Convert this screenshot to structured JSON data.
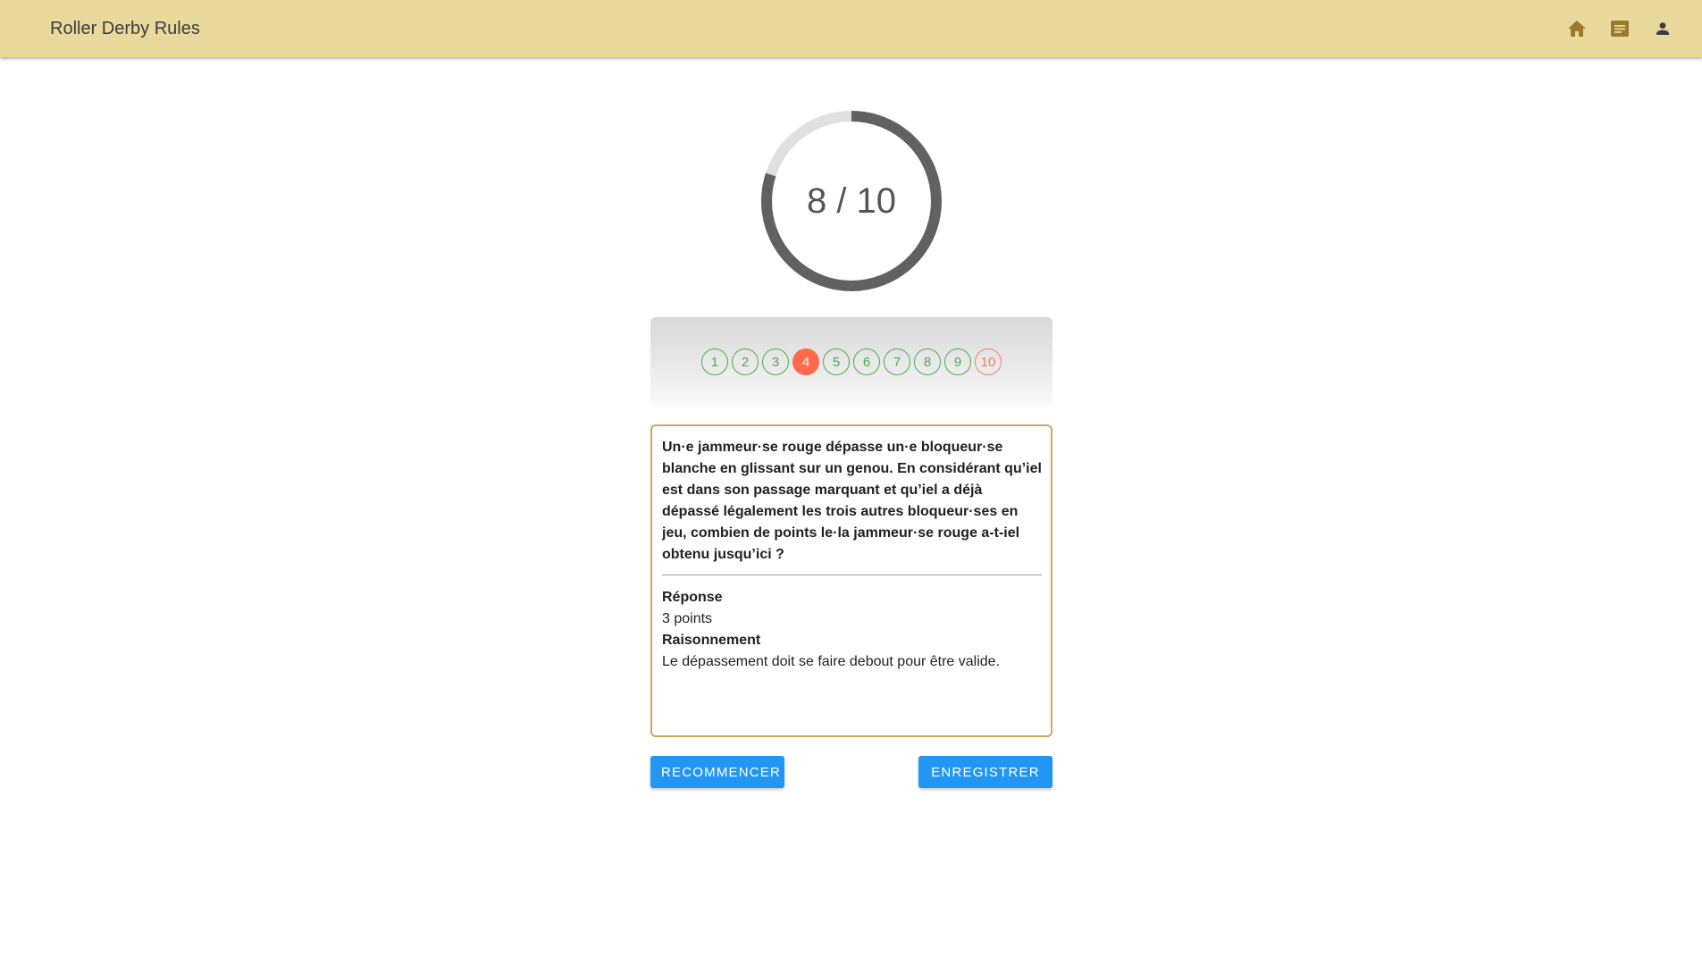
{
  "header": {
    "title": "Roller Derby Rules",
    "icons": [
      "home-icon",
      "quiz-icon",
      "account-icon"
    ]
  },
  "score": {
    "text": "8 / 10",
    "correct": 8,
    "total": 10
  },
  "steps": [
    {
      "label": "1",
      "state": "correct"
    },
    {
      "label": "2",
      "state": "correct"
    },
    {
      "label": "3",
      "state": "correct"
    },
    {
      "label": "4",
      "state": "current"
    },
    {
      "label": "5",
      "state": "correct"
    },
    {
      "label": "6",
      "state": "correct"
    },
    {
      "label": "7",
      "state": "correct"
    },
    {
      "label": "8",
      "state": "correct"
    },
    {
      "label": "9",
      "state": "correct"
    },
    {
      "label": "10",
      "state": "wrong"
    }
  ],
  "card": {
    "question": "Un·e jammeur·se rouge dépasse un·e bloqueur·se blanche en glissant sur un genou. En considérant qu’iel est dans son passage marquant et qu’iel a déjà dépassé légalement les trois autres bloqueur·ses en jeu, combien de points le·la jammeur·se rouge a-t-iel obtenu jusqu’ici ?",
    "answer_label": "Réponse",
    "answer": "3 points",
    "reasoning_label": "Raisonnement",
    "reasoning": "Le dépassement doit se faire debout pour être valide."
  },
  "buttons": {
    "restart": "RECOMMENCER",
    "save": "ENREGISTRER"
  },
  "colors": {
    "appbar": "#e9d99c",
    "icon": "#9c7a2c",
    "correct": "#4caf50",
    "wrong": "#ff7b63",
    "current": "#ff6a4d",
    "ring": "#616161",
    "ring_track": "#e0e0e0",
    "card_border": "#c8a765",
    "button": "#2196f3"
  }
}
